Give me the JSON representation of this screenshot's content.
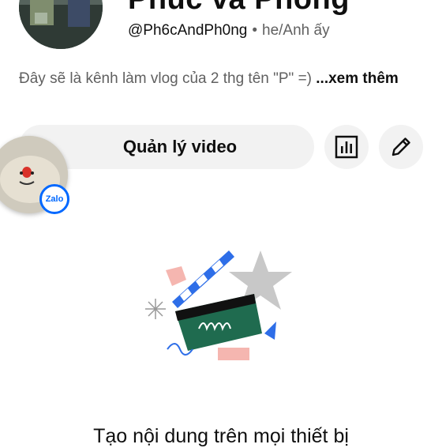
{
  "channel": {
    "name": "Phúc và Phong",
    "handle": "@Ph6cAndPh0ng",
    "separator": "•",
    "pronouns": "he/Anh ấy",
    "description": "Đây sẽ là kênh làm vlog của 2 thg tên \"P\" =)",
    "more_label": "...xem thêm"
  },
  "actions": {
    "manage_videos": "Quản lý video",
    "analytics_icon": "bar-chart-icon",
    "edit_icon": "pencil-icon"
  },
  "overlay": {
    "zalo_label": "Zalo"
  },
  "empty_state": {
    "title": "Tạo nội dung trên mọi thiết bị"
  },
  "colors": {
    "button_bg": "#f2f2f2",
    "secondary_text": "#606060",
    "zalo_blue": "#0068ff",
    "clapper_green": "#1f6b4f"
  }
}
